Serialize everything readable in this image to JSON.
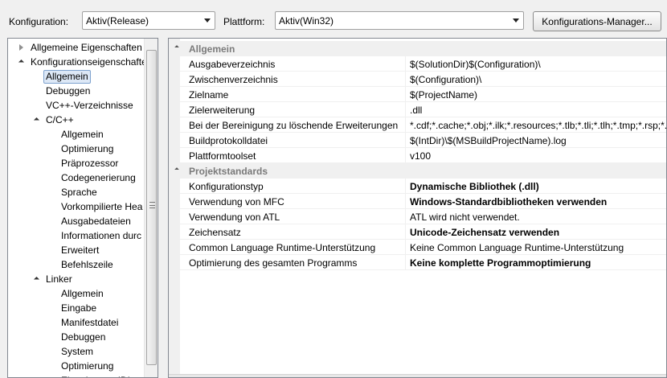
{
  "toolbar": {
    "config_label": "Konfiguration:",
    "config_value": "Aktiv(Release)",
    "platform_label": "Plattform:",
    "platform_value": "Aktiv(Win32)",
    "manager_button": "Konfigurations-Manager..."
  },
  "tree": {
    "items": [
      {
        "label": "Allgemeine Eigenschaften",
        "state": "collapsed"
      },
      {
        "label": "Konfigurationseigenschaften",
        "state": "expanded"
      },
      {
        "label": "Allgemein",
        "state": "selected"
      },
      {
        "label": "Debuggen"
      },
      {
        "label": "VC++-Verzeichnisse"
      },
      {
        "label": "C/C++",
        "state": "expanded"
      },
      {
        "label": "Allgemein"
      },
      {
        "label": "Optimierung"
      },
      {
        "label": "Präprozessor"
      },
      {
        "label": "Codegenerierung"
      },
      {
        "label": "Sprache"
      },
      {
        "label": "Vorkompilierte Hea"
      },
      {
        "label": "Ausgabedateien"
      },
      {
        "label": "Informationen durc"
      },
      {
        "label": "Erweitert"
      },
      {
        "label": "Befehlszeile"
      },
      {
        "label": "Linker",
        "state": "expanded"
      },
      {
        "label": "Allgemein"
      },
      {
        "label": "Eingabe"
      },
      {
        "label": "Manifestdatei"
      },
      {
        "label": "Debuggen"
      },
      {
        "label": "System"
      },
      {
        "label": "Optimierung"
      },
      {
        "label": "Eingebettete IDL"
      }
    ]
  },
  "grid": {
    "rows": [
      {
        "type": "category",
        "name": "Allgemein"
      },
      {
        "name": "Ausgabeverzeichnis",
        "value": "$(SolutionDir)$(Configuration)\\"
      },
      {
        "name": "Zwischenverzeichnis",
        "value": "$(Configuration)\\"
      },
      {
        "name": "Zielname",
        "value": "$(ProjectName)"
      },
      {
        "name": "Zielerweiterung",
        "value": ".dll"
      },
      {
        "name": "Bei der Bereinigung zu löschende Erweiterungen",
        "value": "*.cdf;*.cache;*.obj;*.ilk;*.resources;*.tlb;*.tli;*.tlh;*.tmp;*.rsp;*.pgc;*.pgd"
      },
      {
        "name": "Buildprotokolldatei",
        "value": "$(IntDir)\\$(MSBuildProjectName).log"
      },
      {
        "name": "Plattformtoolset",
        "value": "v100"
      },
      {
        "type": "category",
        "name": "Projektstandards"
      },
      {
        "name": "Konfigurationstyp",
        "value": "Dynamische Bibliothek (.dll)",
        "bold": true
      },
      {
        "name": "Verwendung von MFC",
        "value": "Windows-Standardbibliotheken verwenden",
        "bold": true
      },
      {
        "name": "Verwendung von ATL",
        "value": "ATL wird nicht verwendet."
      },
      {
        "name": "Zeichensatz",
        "value": "Unicode-Zeichensatz verwenden",
        "bold": true
      },
      {
        "name": "Common Language Runtime-Unterstützung",
        "value": "Keine Common Language Runtime-Unterstützung"
      },
      {
        "name": "Optimierung des gesamten Programms",
        "value": "Keine komplette Programmoptimierung",
        "bold": true
      }
    ]
  }
}
